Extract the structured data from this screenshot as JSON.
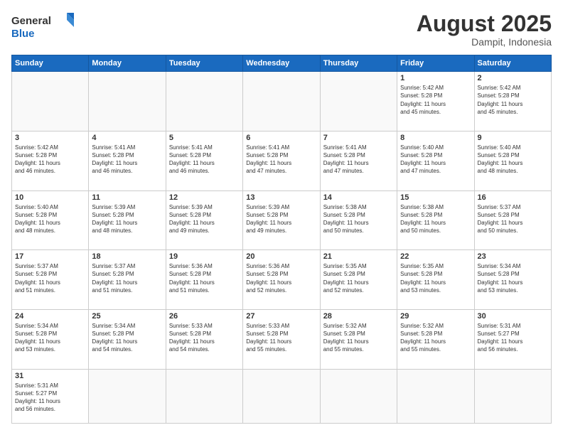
{
  "header": {
    "logo_general": "General",
    "logo_blue": "Blue",
    "month_title": "August 2025",
    "location": "Dampit, Indonesia"
  },
  "days_of_week": [
    "Sunday",
    "Monday",
    "Tuesday",
    "Wednesday",
    "Thursday",
    "Friday",
    "Saturday"
  ],
  "weeks": [
    [
      {
        "day": "",
        "info": ""
      },
      {
        "day": "",
        "info": ""
      },
      {
        "day": "",
        "info": ""
      },
      {
        "day": "",
        "info": ""
      },
      {
        "day": "",
        "info": ""
      },
      {
        "day": "1",
        "info": "Sunrise: 5:42 AM\nSunset: 5:28 PM\nDaylight: 11 hours\nand 45 minutes."
      },
      {
        "day": "2",
        "info": "Sunrise: 5:42 AM\nSunset: 5:28 PM\nDaylight: 11 hours\nand 45 minutes."
      }
    ],
    [
      {
        "day": "3",
        "info": "Sunrise: 5:42 AM\nSunset: 5:28 PM\nDaylight: 11 hours\nand 46 minutes."
      },
      {
        "day": "4",
        "info": "Sunrise: 5:41 AM\nSunset: 5:28 PM\nDaylight: 11 hours\nand 46 minutes."
      },
      {
        "day": "5",
        "info": "Sunrise: 5:41 AM\nSunset: 5:28 PM\nDaylight: 11 hours\nand 46 minutes."
      },
      {
        "day": "6",
        "info": "Sunrise: 5:41 AM\nSunset: 5:28 PM\nDaylight: 11 hours\nand 47 minutes."
      },
      {
        "day": "7",
        "info": "Sunrise: 5:41 AM\nSunset: 5:28 PM\nDaylight: 11 hours\nand 47 minutes."
      },
      {
        "day": "8",
        "info": "Sunrise: 5:40 AM\nSunset: 5:28 PM\nDaylight: 11 hours\nand 47 minutes."
      },
      {
        "day": "9",
        "info": "Sunrise: 5:40 AM\nSunset: 5:28 PM\nDaylight: 11 hours\nand 48 minutes."
      }
    ],
    [
      {
        "day": "10",
        "info": "Sunrise: 5:40 AM\nSunset: 5:28 PM\nDaylight: 11 hours\nand 48 minutes."
      },
      {
        "day": "11",
        "info": "Sunrise: 5:39 AM\nSunset: 5:28 PM\nDaylight: 11 hours\nand 48 minutes."
      },
      {
        "day": "12",
        "info": "Sunrise: 5:39 AM\nSunset: 5:28 PM\nDaylight: 11 hours\nand 49 minutes."
      },
      {
        "day": "13",
        "info": "Sunrise: 5:39 AM\nSunset: 5:28 PM\nDaylight: 11 hours\nand 49 minutes."
      },
      {
        "day": "14",
        "info": "Sunrise: 5:38 AM\nSunset: 5:28 PM\nDaylight: 11 hours\nand 50 minutes."
      },
      {
        "day": "15",
        "info": "Sunrise: 5:38 AM\nSunset: 5:28 PM\nDaylight: 11 hours\nand 50 minutes."
      },
      {
        "day": "16",
        "info": "Sunrise: 5:37 AM\nSunset: 5:28 PM\nDaylight: 11 hours\nand 50 minutes."
      }
    ],
    [
      {
        "day": "17",
        "info": "Sunrise: 5:37 AM\nSunset: 5:28 PM\nDaylight: 11 hours\nand 51 minutes."
      },
      {
        "day": "18",
        "info": "Sunrise: 5:37 AM\nSunset: 5:28 PM\nDaylight: 11 hours\nand 51 minutes."
      },
      {
        "day": "19",
        "info": "Sunrise: 5:36 AM\nSunset: 5:28 PM\nDaylight: 11 hours\nand 51 minutes."
      },
      {
        "day": "20",
        "info": "Sunrise: 5:36 AM\nSunset: 5:28 PM\nDaylight: 11 hours\nand 52 minutes."
      },
      {
        "day": "21",
        "info": "Sunrise: 5:35 AM\nSunset: 5:28 PM\nDaylight: 11 hours\nand 52 minutes."
      },
      {
        "day": "22",
        "info": "Sunrise: 5:35 AM\nSunset: 5:28 PM\nDaylight: 11 hours\nand 53 minutes."
      },
      {
        "day": "23",
        "info": "Sunrise: 5:34 AM\nSunset: 5:28 PM\nDaylight: 11 hours\nand 53 minutes."
      }
    ],
    [
      {
        "day": "24",
        "info": "Sunrise: 5:34 AM\nSunset: 5:28 PM\nDaylight: 11 hours\nand 53 minutes."
      },
      {
        "day": "25",
        "info": "Sunrise: 5:34 AM\nSunset: 5:28 PM\nDaylight: 11 hours\nand 54 minutes."
      },
      {
        "day": "26",
        "info": "Sunrise: 5:33 AM\nSunset: 5:28 PM\nDaylight: 11 hours\nand 54 minutes."
      },
      {
        "day": "27",
        "info": "Sunrise: 5:33 AM\nSunset: 5:28 PM\nDaylight: 11 hours\nand 55 minutes."
      },
      {
        "day": "28",
        "info": "Sunrise: 5:32 AM\nSunset: 5:28 PM\nDaylight: 11 hours\nand 55 minutes."
      },
      {
        "day": "29",
        "info": "Sunrise: 5:32 AM\nSunset: 5:28 PM\nDaylight: 11 hours\nand 55 minutes."
      },
      {
        "day": "30",
        "info": "Sunrise: 5:31 AM\nSunset: 5:27 PM\nDaylight: 11 hours\nand 56 minutes."
      }
    ],
    [
      {
        "day": "31",
        "info": "Sunrise: 5:31 AM\nSunset: 5:27 PM\nDaylight: 11 hours\nand 56 minutes."
      },
      {
        "day": "",
        "info": ""
      },
      {
        "day": "",
        "info": ""
      },
      {
        "day": "",
        "info": ""
      },
      {
        "day": "",
        "info": ""
      },
      {
        "day": "",
        "info": ""
      },
      {
        "day": "",
        "info": ""
      }
    ]
  ]
}
